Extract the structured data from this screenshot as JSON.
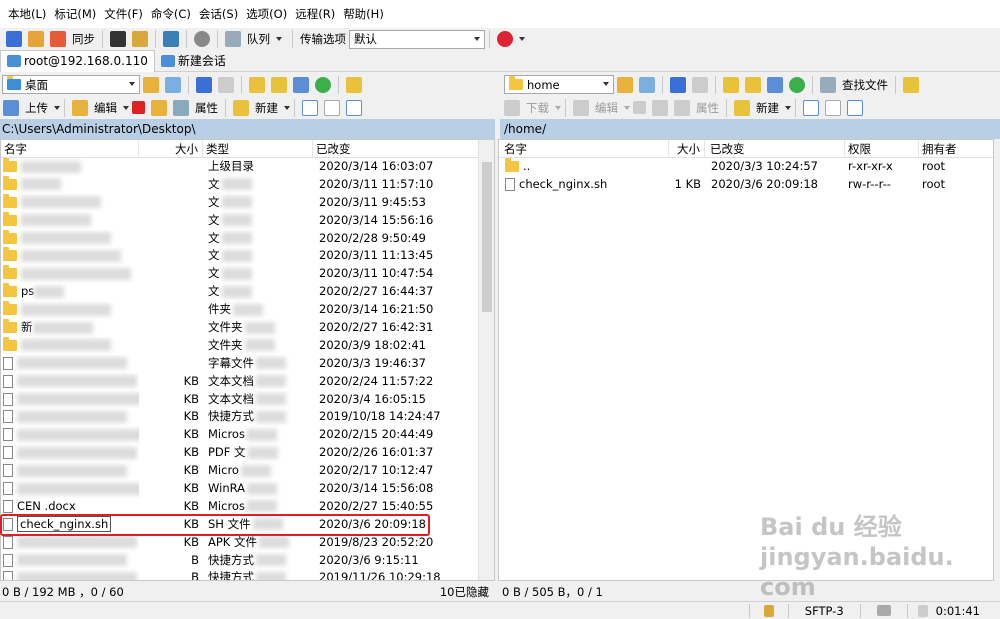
{
  "menu": [
    "本地(L)",
    "标记(M)",
    "文件(F)",
    "命令(C)",
    "会话(S)",
    "选项(O)",
    "远程(R)",
    "帮助(H)"
  ],
  "toolbar": {
    "sync_label": "同步",
    "queue_label": "队列",
    "transfer_options_label": "传输选项",
    "transfer_default": "默认"
  },
  "tabs": {
    "session": "root@192.168.0.110",
    "new_session": "新建会话"
  },
  "left": {
    "location": "桌面",
    "actions": {
      "upload": "上传",
      "edit": "编辑",
      "properties": "属性",
      "new": "新建"
    },
    "path": "C:\\Users\\Administrator\\Desktop\\",
    "columns": [
      "名字",
      "大小",
      "类型",
      "已改变"
    ],
    "rows": [
      {
        "name": "",
        "size": "",
        "type": "上级目录",
        "modified": "2020/3/14  16:03:07"
      },
      {
        "name": "",
        "size": "",
        "type": "文",
        "modified": "2020/3/11  11:57:10"
      },
      {
        "name": "",
        "size": "",
        "type": "文",
        "modified": "2020/3/11  9:45:53"
      },
      {
        "name": "",
        "size": "",
        "type": "文",
        "modified": "2020/3/14  15:56:16"
      },
      {
        "name": "",
        "size": "",
        "type": "文",
        "modified": "2020/2/28  9:50:49"
      },
      {
        "name": "",
        "size": "",
        "type": "文",
        "modified": "2020/3/11  11:13:45"
      },
      {
        "name": "",
        "size": "",
        "type": "文",
        "modified": "2020/3/11  10:47:54"
      },
      {
        "name": "ps",
        "size": "",
        "type": "文",
        "modified": "2020/2/27  16:44:37"
      },
      {
        "name": "",
        "size": "",
        "type": "件夹",
        "modified": "2020/3/14  16:21:50"
      },
      {
        "name": "新",
        "size": "",
        "type": "文件夹",
        "modified": "2020/2/27  16:42:31"
      },
      {
        "name": "",
        "size": "",
        "type": "文件夹",
        "modified": "2020/3/9  18:02:41"
      },
      {
        "name": "",
        "size": "",
        "type": "字幕文件",
        "modified": "2020/3/3  19:46:37"
      },
      {
        "name": "",
        "size": "KB",
        "type": "文本文档",
        "modified": "2020/2/24  11:57:22"
      },
      {
        "name": "",
        "size": "KB",
        "type": "文本文档",
        "modified": "2020/3/4  16:05:15"
      },
      {
        "name": "",
        "size": "KB",
        "type": "快捷方式",
        "modified": "2019/10/18  14:24:47"
      },
      {
        "name": "",
        "size": "KB",
        "type": "Micros",
        "modified": "2020/2/15  20:44:49"
      },
      {
        "name": "",
        "size": "KB",
        "type": "PDF 文",
        "modified": "2020/2/26  16:01:37"
      },
      {
        "name": "",
        "size": "KB",
        "type": "Micro",
        "modified": "2020/2/17  10:12:47"
      },
      {
        "name": "",
        "size": "KB",
        "type": "WinRA",
        "modified": "2020/3/14  15:56:08"
      },
      {
        "name": "CEN    .docx",
        "size": "KB",
        "type": "Micros",
        "modified": "2020/2/27  15:40:55"
      },
      {
        "name": "check_nginx.sh",
        "size": "KB",
        "type": "SH 文件",
        "modified": "2020/3/6  20:09:18"
      },
      {
        "name": "",
        "size": "KB",
        "type": "APK 文件",
        "modified": "2019/8/23  20:52:20"
      },
      {
        "name": "",
        "size": "B",
        "type": "快捷方式",
        "modified": "2020/3/6  9:15:11"
      },
      {
        "name": "",
        "size": "B",
        "type": "快捷方式",
        "modified": "2019/11/26  10:29:18"
      }
    ],
    "status": "0 B / 192 MB ，0 / 60",
    "hidden": "10已隐藏"
  },
  "right": {
    "location": "home",
    "find_files": "查找文件",
    "actions": {
      "download": "下载",
      "edit": "编辑",
      "properties": "属性",
      "new": "新建"
    },
    "path": "/home/",
    "columns": [
      "名字",
      "大小",
      "已改变",
      "权限",
      "拥有者"
    ],
    "rows": [
      {
        "name": "..",
        "size": "",
        "modified": "2020/3/3  10:24:57",
        "perm": "r-xr-xr-x",
        "owner": "root"
      },
      {
        "name": "check_nginx.sh",
        "size": "1 KB",
        "modified": "2020/3/6  20:09:18",
        "perm": "rw-r--r--",
        "owner": "root"
      }
    ],
    "status": "0 B / 505 B，0 / 1"
  },
  "statusbar": {
    "protocol": "SFTP-3",
    "time": "0:01:41"
  },
  "watermark": "Bai du 经验 jingyan.baidu.com",
  "colors": {
    "path_bar": "#b9cfe6",
    "highlight": "#e02020"
  }
}
